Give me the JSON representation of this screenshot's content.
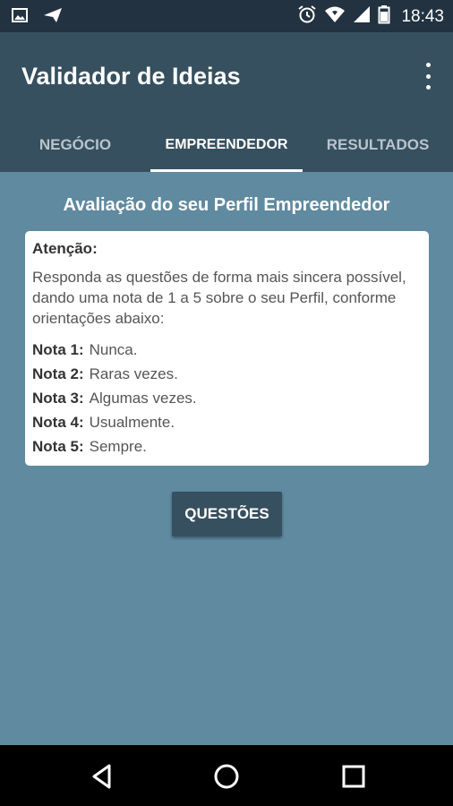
{
  "statusbar": {
    "time": "18:43",
    "icons": [
      "image-icon",
      "send-icon",
      "alarm-icon",
      "wifi-icon",
      "signal-icon",
      "battery-icon"
    ]
  },
  "appbar": {
    "title": "Validador de Ideias",
    "menu_icon": "overflow-menu-icon"
  },
  "tabs": [
    {
      "label": "NEGÓCIO",
      "active": false
    },
    {
      "label": "EMPREENDEDOR",
      "active": true
    },
    {
      "label": "RESULTADOS",
      "active": false
    }
  ],
  "content": {
    "heading": "Avaliação do seu Perfil Empreendedor",
    "card": {
      "attention": "Atenção:",
      "description": "Responda as questões de forma mais sincera possível, dando uma nota de 1 a 5 sobre o seu Perfil, conforme orientações abaixo:",
      "notes": [
        {
          "key": "Nota 1:",
          "value": "Nunca."
        },
        {
          "key": "Nota 2:",
          "value": "Raras vezes."
        },
        {
          "key": "Nota 3:",
          "value": "Algumas vezes."
        },
        {
          "key": "Nota 4:",
          "value": "Usualmente."
        },
        {
          "key": "Nota 5:",
          "value": "Sempre."
        }
      ]
    },
    "button_label": "QUESTÕES"
  },
  "navbar": {
    "icons": [
      "back-icon",
      "home-icon",
      "recents-icon"
    ]
  },
  "colors": {
    "statusbar": "#223240",
    "appbar": "#36505f",
    "background": "#5f8aa0",
    "button": "#36505f"
  }
}
